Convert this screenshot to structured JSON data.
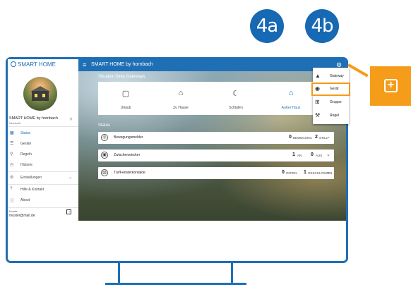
{
  "callouts": {
    "a": "4a",
    "b": "4b"
  },
  "topbar": {
    "brand": "SMART HOME",
    "title": "SMART HOME by hornbach"
  },
  "sidebar": {
    "home_name": "SMART HOME by hornbach",
    "home_sub": "Neustadt",
    "items": [
      {
        "label": "Status",
        "icon": "grid-icon",
        "active": true
      },
      {
        "label": "Geräte",
        "icon": "list-icon",
        "active": false
      },
      {
        "label": "Regeln",
        "icon": "search-icon",
        "active": false
      },
      {
        "label": "Historie",
        "icon": "clock-icon",
        "active": false
      },
      {
        "label": "Einstellungen",
        "icon": "gear-icon",
        "active": false
      },
      {
        "label": "Hilfe & Kontakt",
        "icon": "help-icon",
        "active": false
      },
      {
        "label": "About",
        "icon": "info-icon",
        "active": false
      }
    ],
    "footer_label": "Kunde",
    "footer_mail": "muster@mail.de"
  },
  "main": {
    "situations_title": "Situation ihres Gateways",
    "situations": [
      {
        "label": "Urlaub",
        "icon": "suitcase-icon",
        "active": false
      },
      {
        "label": "Zu Hause",
        "icon": "home-outline-icon",
        "active": false
      },
      {
        "label": "Schlafen",
        "icon": "moon-icon",
        "active": false
      },
      {
        "label": "Außer Haus",
        "icon": "home-filled-icon",
        "active": true
      }
    ],
    "status_title": "Status",
    "devices": [
      {
        "name": "Bewegungsmelder",
        "v1": "0",
        "l1": "BEWEGUNG",
        "v2": "2",
        "l2": "STILL"
      },
      {
        "name": "Zwischenstecker",
        "v1": "1",
        "l1": "AN",
        "v2": "0",
        "l2": "AUS"
      },
      {
        "name": "Tür/Fensterkontakte",
        "v1": "0",
        "l1": "OFFEN",
        "v2": "1",
        "l2": "GESCHLOSSEN"
      }
    ]
  },
  "add_menu": {
    "items": [
      {
        "label": "Gateway",
        "icon": "gateway-icon"
      },
      {
        "label": "Gerät",
        "icon": "device-icon",
        "highlighted": true
      },
      {
        "label": "Gruppe",
        "icon": "group-icon"
      },
      {
        "label": "Regel",
        "icon": "wrench-icon"
      }
    ]
  },
  "plus_tag": {
    "symbol": "+"
  },
  "colors": {
    "accent": "#1f6fb5",
    "highlight": "#f59c1a"
  }
}
